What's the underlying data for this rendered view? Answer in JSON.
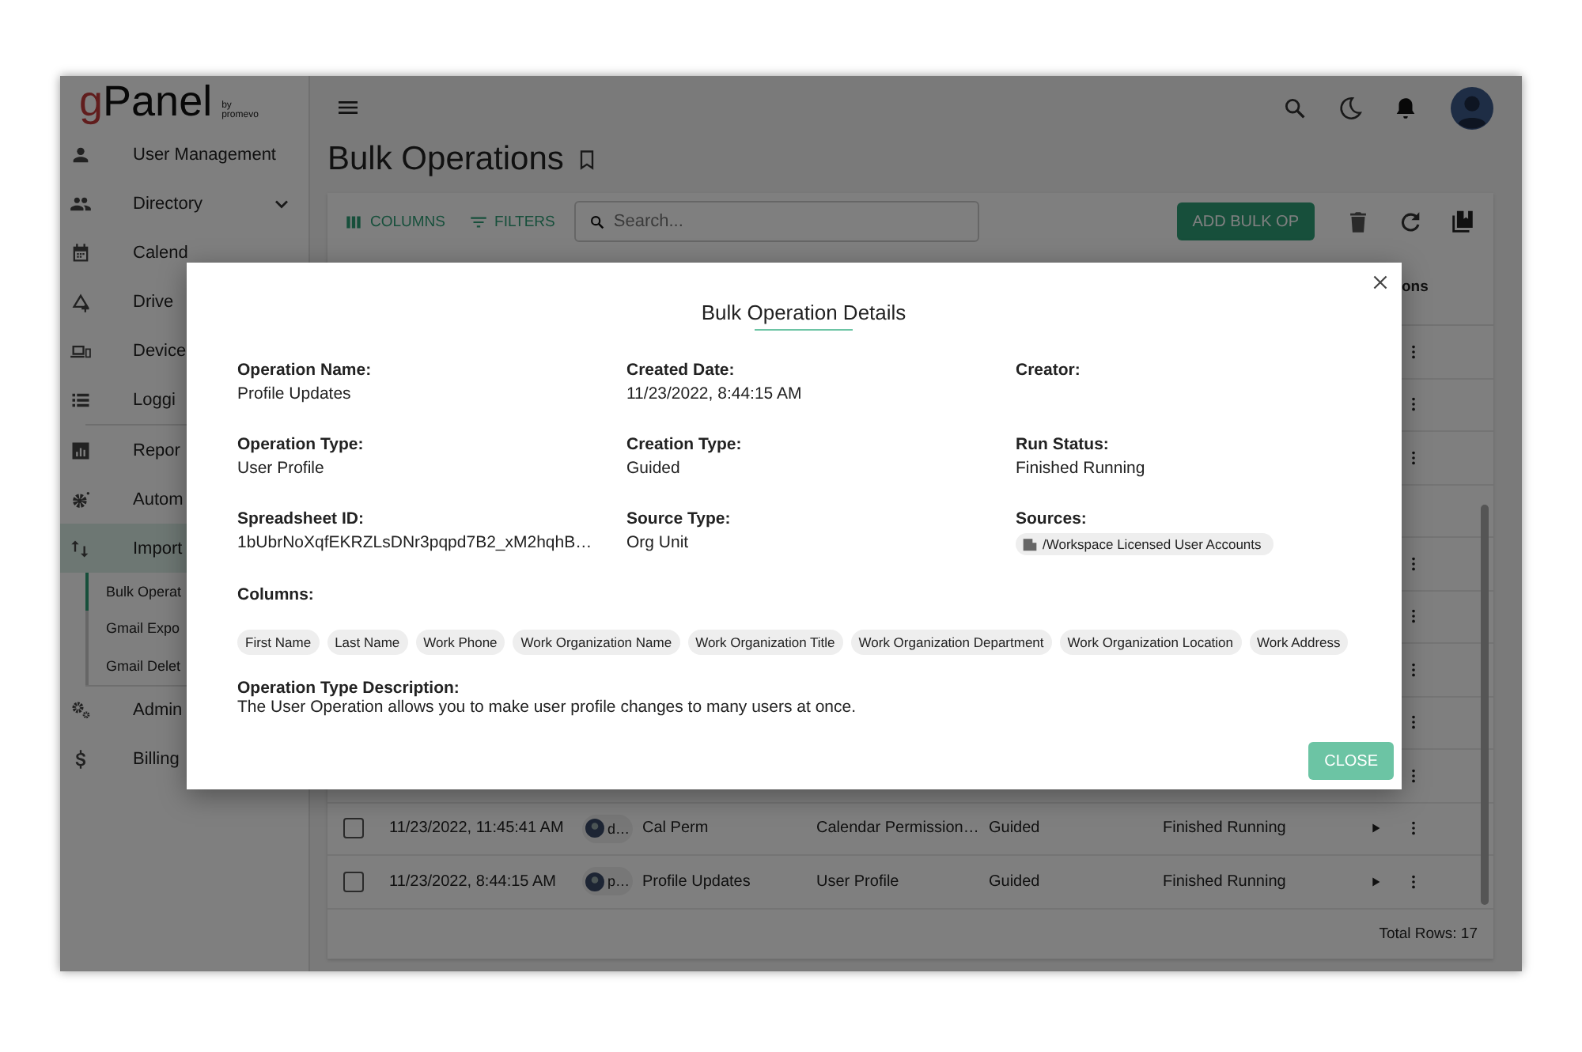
{
  "logo": {
    "brand_first": "g",
    "brand_rest": "Panel",
    "byline": "by",
    "company": "promevo"
  },
  "sidebar": {
    "sections": [
      [
        {
          "label": "User Management",
          "selected": false
        },
        {
          "label": "Directory",
          "selected": false,
          "expandable": true
        },
        {
          "label": "Calend",
          "selected": false
        },
        {
          "label": "Drive",
          "selected": false
        },
        {
          "label": "Device",
          "selected": false
        },
        {
          "label": "Loggi",
          "selected": false
        }
      ],
      [
        {
          "label": "Repor",
          "selected": false
        },
        {
          "label": "Autom",
          "selected": false
        },
        {
          "label": "Import",
          "selected": true,
          "children": [
            {
              "label": "Bulk Operat",
              "selected": true
            },
            {
              "label": "Gmail Expo",
              "selected": false
            },
            {
              "label": "Gmail Delet",
              "selected": false
            }
          ]
        }
      ],
      [
        {
          "label": "Admin",
          "selected": false
        },
        {
          "label": "Billing",
          "selected": false
        }
      ]
    ]
  },
  "page": {
    "title": "Bulk Operations"
  },
  "toolbar": {
    "columns_button": "COLUMNS",
    "filters_button": "FILTERS",
    "search": {
      "placeholder": "Search..."
    },
    "add_button": "ADD BULK OP"
  },
  "table": {
    "last_column_partial": "ons",
    "rows": [
      {
        "kind": "partial"
      },
      {
        "kind": "partial"
      },
      {
        "kind": "partial"
      },
      {
        "kind": "blank"
      },
      {
        "kind": "partial"
      },
      {
        "kind": "partial"
      },
      {
        "kind": "partial"
      },
      {
        "kind": "partial"
      },
      {
        "kind": "partial"
      },
      {
        "kind": "full",
        "checked": false,
        "created": "11/23/2022, 11:45:41 AM",
        "creator": "d…",
        "name": "Cal Perm",
        "type": "Calendar Permission…",
        "creation_type": "Guided",
        "status": "Finished Running"
      },
      {
        "kind": "full",
        "checked": false,
        "created": "11/23/2022, 8:44:15 AM",
        "creator": "p…",
        "name": "Profile Updates",
        "type": "User Profile",
        "creation_type": "Guided",
        "status": "Finished Running"
      }
    ],
    "total": "Total Rows: 17"
  },
  "dialog": {
    "title": "Bulk Operation Details",
    "fields": [
      {
        "label": "Operation Name:",
        "kind": "text",
        "value": "Profile Updates"
      },
      {
        "label": "Created Date:",
        "kind": "text",
        "value": "11/23/2022, 8:44:15 AM"
      },
      {
        "label": "Creator:",
        "kind": "text"
      },
      {
        "label": "Operation Type:",
        "kind": "text",
        "value": "User Profile"
      },
      {
        "label": "Creation Type:",
        "kind": "text",
        "value": "Guided"
      },
      {
        "label": "Run Status:",
        "kind": "text",
        "value": "Finished Running"
      },
      {
        "label": "Spreadsheet ID:",
        "kind": "text",
        "value": "1bUbrNoXqfEKRZLsDNr3pqpd7B2_xM2hqhB…"
      },
      {
        "label": "Source Type:",
        "kind": "text",
        "value": "Org Unit"
      },
      {
        "label": "Sources:",
        "kind": "chip",
        "value": "/Workspace Licensed User Accounts"
      }
    ],
    "columns_label": "Columns:",
    "columns": [
      "First Name",
      "Last Name",
      "Work Phone",
      "Work Organization Name",
      "Work Organization Title",
      "Work Organization Department",
      "Work Organization Location",
      "Work Address"
    ],
    "description_label": "Operation Type Description:",
    "description": "The User Operation allows you to make user profile changes to many users at once.",
    "close_button": "CLOSE"
  }
}
